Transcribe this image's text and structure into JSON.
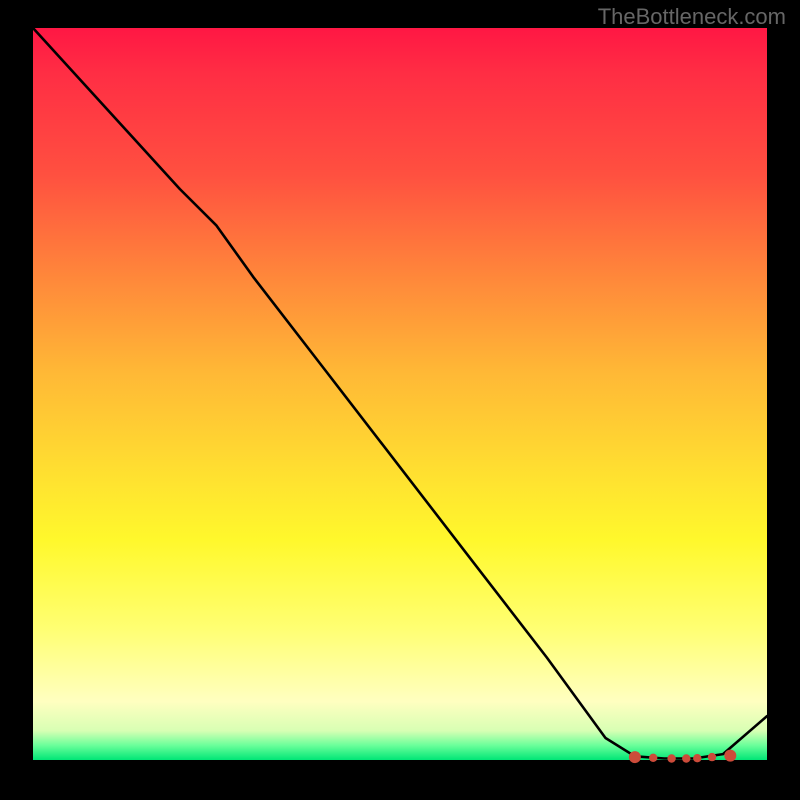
{
  "watermark": "TheBottleneck.com",
  "chart_data": {
    "type": "line",
    "title": "",
    "xlabel": "",
    "ylabel": "",
    "xlim": [
      0,
      100
    ],
    "ylim": [
      0,
      100
    ],
    "series": [
      {
        "name": "curve",
        "x": [
          0,
          10,
          20,
          25,
          30,
          40,
          50,
          60,
          70,
          78,
          82,
          86,
          90,
          94,
          100
        ],
        "y": [
          100,
          89,
          78,
          73,
          66,
          53,
          40,
          27,
          14,
          3,
          0.5,
          0.2,
          0.2,
          0.8,
          6
        ]
      }
    ],
    "markers": {
      "name": "highlight-points",
      "color": "#cc4b3a",
      "x": [
        82,
        84.5,
        87,
        89,
        90.5,
        92.5,
        95
      ],
      "y": [
        0.4,
        0.3,
        0.2,
        0.2,
        0.25,
        0.4,
        0.6
      ]
    }
  }
}
